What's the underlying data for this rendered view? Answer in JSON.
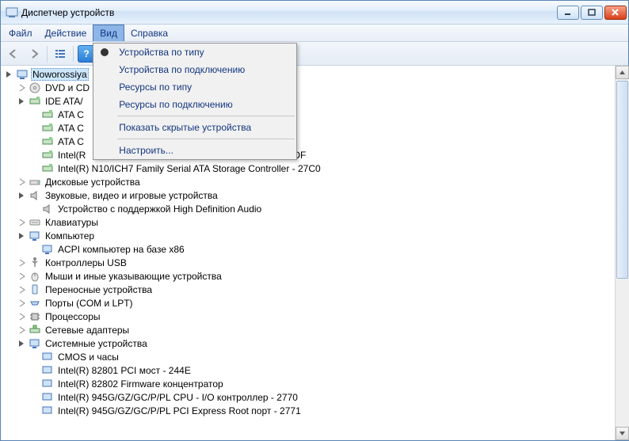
{
  "window": {
    "title": "Диспетчер устройств"
  },
  "menubar": {
    "file": "Файл",
    "action": "Действие",
    "view": "Вид",
    "help": "Справка"
  },
  "viewMenu": {
    "byType": "Устройства по типу",
    "byConnection": "Устройства по подключению",
    "resByType": "Ресурсы по типу",
    "resByConn": "Ресурсы по подключению",
    "showHidden": "Показать скрытые устройства",
    "customize": "Настроить..."
  },
  "tree": {
    "root": "Noworossiya",
    "dvd": "DVD и CD",
    "ide": "IDE ATA/",
    "ata0": "ATA C",
    "ata1": "ATA C",
    "ata2": "ATA C",
    "intelR": "Intel(R",
    "intelN10": "Intel(R) N10/ICH7 Family Serial ATA Storage Controller - 27C0",
    "disk": "Дисковые устройства",
    "sound": "Звуковые, видео и игровые устройства",
    "hdaudio": "Устройство с поддержкой High Definition Audio",
    "keyboards": "Клавиатуры",
    "computer": "Компьютер",
    "acpi": "ACPI компьютер на базе x86",
    "usb": "Контроллеры USB",
    "mice": "Мыши и иные указывающие устройства",
    "portable": "Переносные устройства",
    "ports": "Порты (COM и LPT)",
    "cpus": "Процессоры",
    "netadapters": "Сетевые адаптеры",
    "sysdev": "Системные устройства",
    "cmos": "CMOS и часы",
    "pci244E": "Intel(R) 82801 PCI мост - 244E",
    "fw82802": "Intel(R) 82802 Firmware концентратор",
    "io2770": "Intel(R) 945G/GZ/GC/P/PL CPU - I/O контроллер - 2770",
    "root2771": "Intel(R) 945G/GZ/GC/P/PL PCI Express Root порт - 2771",
    "partialPDF": "DF"
  }
}
